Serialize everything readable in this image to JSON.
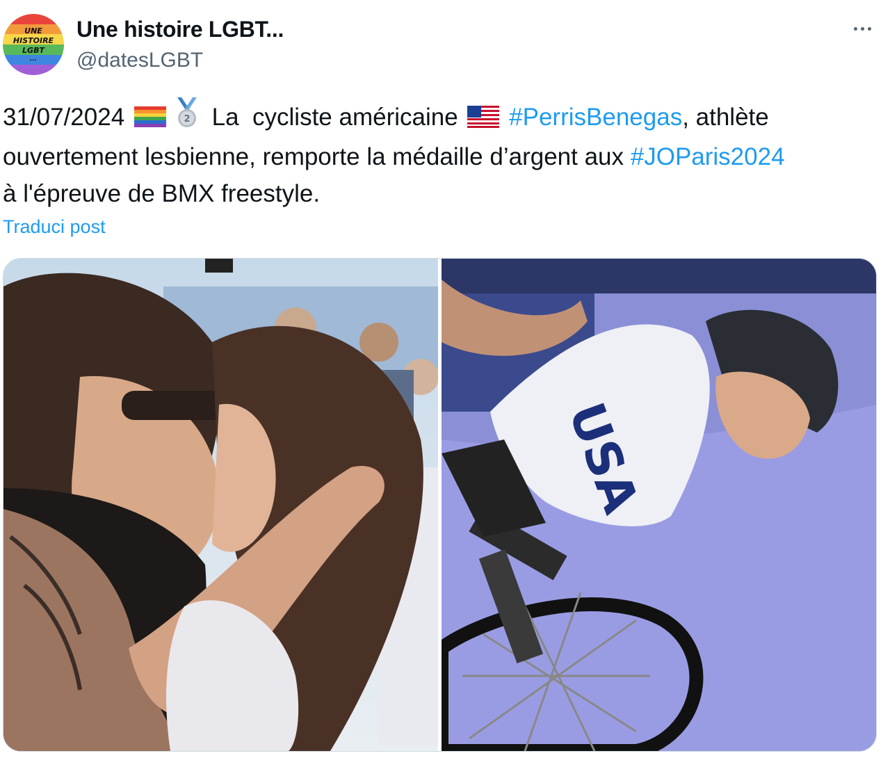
{
  "author": {
    "avatar_lines": [
      "UNE",
      "HISTOIRE",
      "LGBT",
      "..."
    ],
    "display_name": "Une histoire LGBT...",
    "handle": "@datesLGBT"
  },
  "icons": {
    "more": "more-horizontal-icon",
    "flag_rainbow": "rainbow-flag-icon",
    "medal": "silver-medal-icon",
    "flag_usa": "us-flag-icon"
  },
  "tweet": {
    "date": "31/07/2024",
    "text_a": "La  cycliste américaine",
    "hashtag_1": "#PerrisBenegas",
    "text_b": ", athlète",
    "text_c": "ouvertement lesbienne, remporte la médaille d’argent aux",
    "hashtag_2": "#JOParis2024",
    "text_d": "à l'épreuve de BMX freestyle."
  },
  "translate_label": "Traduci post",
  "media": {
    "photo_left_jersey": "",
    "photo_right_jersey": "USA"
  },
  "colors": {
    "link": "#1d9bf0",
    "secondary_text": "#536471",
    "text": "#0f1419",
    "border": "#cfd9de"
  }
}
